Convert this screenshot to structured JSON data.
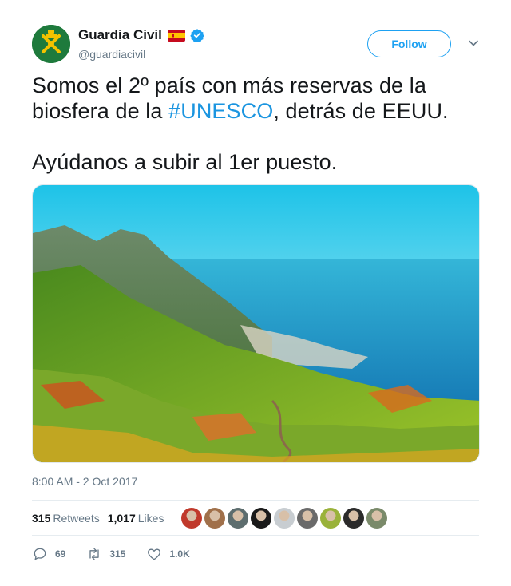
{
  "author": {
    "display_name": "Guardia Civil",
    "handle": "@guardiacivil",
    "verified": true,
    "flag": "spain-flag-icon",
    "avatar_color": "#1e7a3c"
  },
  "follow_label": "Follow",
  "tweet": {
    "line1_before": "Somos el 2º país con más reservas de la biosfera de la ",
    "hashtag": "#UNESCO",
    "line1_after": ", detrás de EEUU.",
    "line2": "Ayúdanos a subir al 1er puesto."
  },
  "timestamp": "8:00 AM - 2 Oct 2017",
  "stats": {
    "retweets_count": "315",
    "retweets_label": "Retweets",
    "likes_count": "1,017",
    "likes_label": "Likes"
  },
  "likers": [
    {
      "color": "#c0392b"
    },
    {
      "color": "#a0704a"
    },
    {
      "color": "#5d6d6e"
    },
    {
      "color": "#1a1a1a"
    },
    {
      "color": "#c8cdd1"
    },
    {
      "color": "#6a6a6a"
    },
    {
      "color": "#9ab23a"
    },
    {
      "color": "#2b2b2b"
    },
    {
      "color": "#7a8a6a"
    }
  ],
  "actions": {
    "replies": "69",
    "retweets": "315",
    "likes": "1.0K"
  },
  "colors": {
    "accent": "#1da1f2",
    "hashtag": "#1b95e0",
    "muted": "#657786"
  }
}
